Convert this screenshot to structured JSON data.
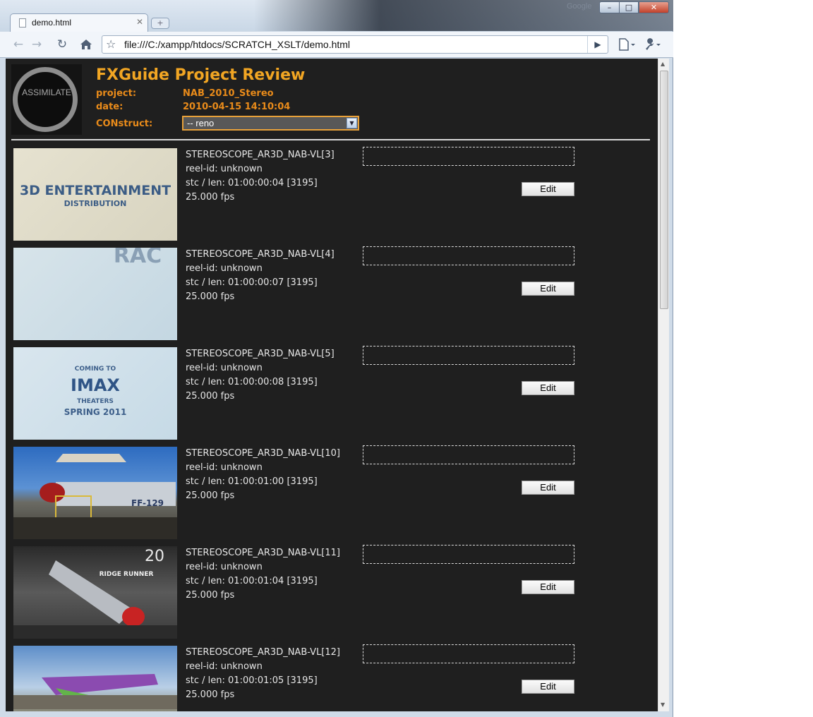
{
  "browser": {
    "tab_title": "demo.html",
    "url": "file:///C:/xampp/htdocs/SCRATCH_XSLT/demo.html",
    "google_label": "Google",
    "icons": [
      "back-icon",
      "forward-icon",
      "reload-icon",
      "home-icon",
      "star-icon",
      "go-icon",
      "page-menu-icon",
      "wrench-icon"
    ]
  },
  "header": {
    "logo_text": "ASSIMILATE",
    "title": "FXGuide Project Review",
    "project_label": "project:",
    "project_value": "NAB_2010_Stereo",
    "date_label": "date:",
    "date_value": "2010-04-15 14:10:04",
    "construct_label": "CONstruct:",
    "construct_value": "-- reno"
  },
  "clips": [
    {
      "name": "STEREOSCOPE_AR3D_NAB-VL[3]",
      "reel": "reel-id: unknown",
      "stc": "stc / len: 01:00:00:04 [3195]",
      "fps": "25.000 fps",
      "edit": "Edit",
      "thumb_text": [
        "3D ENTERTAINMENT",
        "DISTRIBUTION"
      ]
    },
    {
      "name": "STEREOSCOPE_AR3D_NAB-VL[4]",
      "reel": "reel-id: unknown",
      "stc": "stc / len: 01:00:00:07 [3195]",
      "fps": "25.000 fps",
      "edit": "Edit",
      "thumb_text": [
        "RAC"
      ]
    },
    {
      "name": "STEREOSCOPE_AR3D_NAB-VL[5]",
      "reel": "reel-id: unknown",
      "stc": "stc / len: 01:00:00:08 [3195]",
      "fps": "25.000 fps",
      "edit": "Edit",
      "thumb_text": [
        "COMING TO",
        "IMAX",
        "THEATERS",
        "SPRING 2011"
      ]
    },
    {
      "name": "STEREOSCOPE_AR3D_NAB-VL[10]",
      "reel": "reel-id: unknown",
      "stc": "stc / len: 01:00:01:00 [3195]",
      "fps": "25.000 fps",
      "edit": "Edit",
      "thumb_text": [
        "FF-129"
      ]
    },
    {
      "name": "STEREOSCOPE_AR3D_NAB-VL[11]",
      "reel": "reel-id: unknown",
      "stc": "stc / len: 01:00:01:04 [3195]",
      "fps": "25.000 fps",
      "edit": "Edit",
      "thumb_text": [
        "20",
        "RIDGE RUNNER"
      ]
    },
    {
      "name": "STEREOSCOPE_AR3D_NAB-VL[12]",
      "reel": "reel-id: unknown",
      "stc": "stc / len: 01:00:01:05 [3195]",
      "fps": "25.000 fps",
      "edit": "Edit",
      "thumb_text": []
    }
  ],
  "colors": {
    "accent": "#f2a623",
    "label": "#e98b1a",
    "page_bg": "#1f1f1f",
    "text": "#e6e6e6"
  }
}
